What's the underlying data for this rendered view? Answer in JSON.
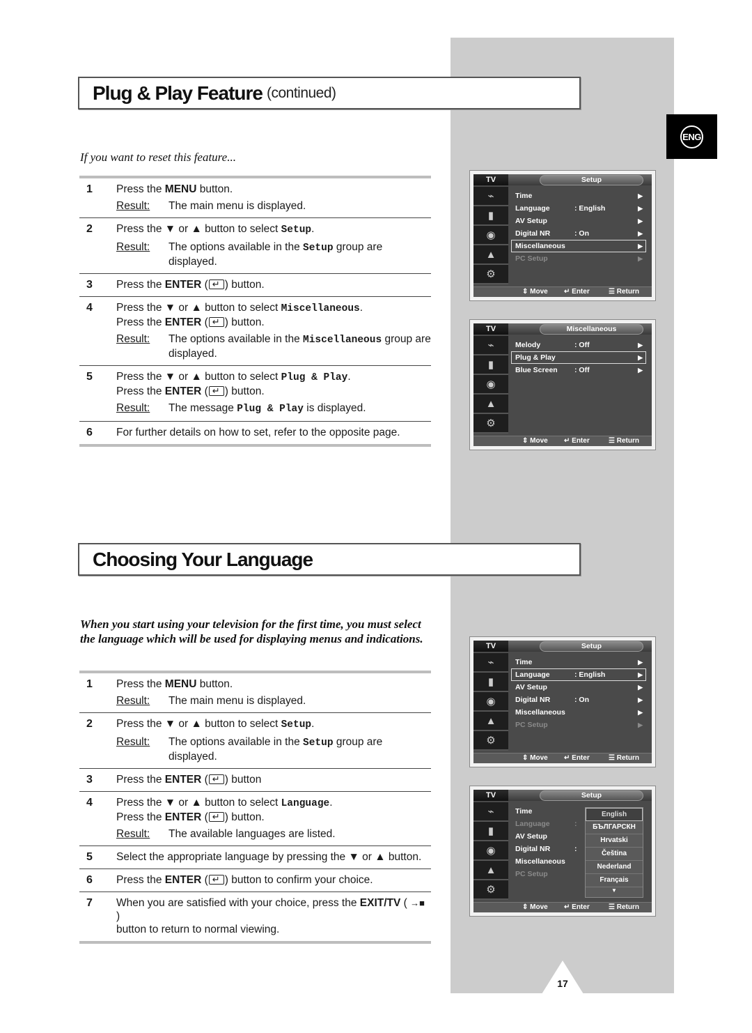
{
  "page_number": "17",
  "language_badge": "ENG",
  "section1": {
    "title": "Plug & Play Feature",
    "title_suffix": "(continued)",
    "intro": "If you want to reset this feature...",
    "steps": [
      {
        "num": "1",
        "parts": [
          "Press the ",
          "MENU",
          " button."
        ],
        "result_label": "Result:",
        "result": "The main menu is displayed."
      },
      {
        "num": "2",
        "parts": [
          "Press the ▼ or ▲ button to select ",
          "Setup",
          "."
        ],
        "result_label": "Result:",
        "result_parts": [
          "The options available in the ",
          "Setup",
          " group are displayed."
        ]
      },
      {
        "num": "3",
        "parts": [
          "Press the ",
          "ENTER",
          " (",
          ") button."
        ]
      },
      {
        "num": "4",
        "line1": [
          "Press the ▼ or ▲ button to select ",
          "Miscellaneous",
          "."
        ],
        "line2": [
          "Press the ",
          "ENTER",
          " (",
          ") button."
        ],
        "result_label": "Result:",
        "result_parts": [
          "The options available in the ",
          "Miscellaneous",
          " group are displayed."
        ]
      },
      {
        "num": "5",
        "line1": [
          "Press the ▼ or ▲ button to select ",
          "Plug & Play",
          "."
        ],
        "line2": [
          "Press the ",
          "ENTER",
          " (",
          ") button."
        ],
        "result_label": "Result:",
        "result_parts": [
          "The message ",
          "Plug & Play",
          " is displayed."
        ]
      },
      {
        "num": "6",
        "text": "For further details on how to set, refer to the opposite page."
      }
    ]
  },
  "section2": {
    "title": "Choosing Your Language",
    "intro": "When you start using your television for the first time, you must select the language which will be used for displaying menus and indications.",
    "steps": [
      {
        "num": "1",
        "parts": [
          "Press the ",
          "MENU",
          " button."
        ],
        "result_label": "Result:",
        "result": "The main menu is displayed."
      },
      {
        "num": "2",
        "parts": [
          "Press the ▼ or ▲ button to select ",
          "Setup",
          "."
        ],
        "result_label": "Result:",
        "result_parts": [
          "The options available in the ",
          "Setup",
          " group are displayed."
        ]
      },
      {
        "num": "3",
        "parts": [
          "Press the ",
          "ENTER",
          " (",
          ") button"
        ]
      },
      {
        "num": "4",
        "line1": [
          "Press the ▼ or ▲ button to select ",
          "Language",
          "."
        ],
        "line2": [
          "Press the ",
          "ENTER",
          " (",
          ") button."
        ],
        "result_label": "Result:",
        "result": "The available languages are listed."
      },
      {
        "num": "5",
        "text": "Select the appropriate language by pressing the ▼ or ▲ button."
      },
      {
        "num": "6",
        "parts": [
          "Press the ",
          "ENTER",
          " (",
          ") button to confirm your choice."
        ]
      },
      {
        "num": "7",
        "parts": [
          "When you are satisfied with your choice, press the ",
          "EXIT/TV",
          " ( ",
          " )"
        ],
        "line2": "button to return to normal viewing."
      }
    ]
  },
  "osd_common": {
    "tv_label": "TV",
    "icons": [
      "input-icon",
      "picture-icon",
      "sound-icon",
      "channel-icon",
      "setup-icon"
    ],
    "footer": {
      "move": "Move",
      "enter": "Enter",
      "return": "Return"
    }
  },
  "osd_screens": [
    {
      "header": "Setup",
      "rows": [
        {
          "label": "Time",
          "value": "",
          "arrow": "▶",
          "selected": false,
          "dim": false
        },
        {
          "label": "Language",
          "value": ": English",
          "arrow": "▶",
          "selected": false,
          "dim": false
        },
        {
          "label": "AV Setup",
          "value": "",
          "arrow": "▶",
          "selected": false,
          "dim": false
        },
        {
          "label": "Digital NR",
          "value": ": On",
          "arrow": "▶",
          "selected": false,
          "dim": false
        },
        {
          "label": "Miscellaneous",
          "value": "",
          "arrow": "▶",
          "selected": true,
          "dim": false
        },
        {
          "label": "PC Setup",
          "value": "",
          "arrow": "▶",
          "selected": false,
          "dim": true
        }
      ]
    },
    {
      "header": "Miscellaneous",
      "rows": [
        {
          "label": "Melody",
          "value": ": Off",
          "arrow": "▶",
          "selected": false,
          "dim": false
        },
        {
          "label": "Plug & Play",
          "value": "",
          "arrow": "▶",
          "selected": true,
          "dim": false
        },
        {
          "label": "Blue Screen",
          "value": ": Off",
          "arrow": "▶",
          "selected": false,
          "dim": false
        }
      ]
    },
    {
      "header": "Setup",
      "rows": [
        {
          "label": "Time",
          "value": "",
          "arrow": "▶",
          "selected": false,
          "dim": false
        },
        {
          "label": "Language",
          "value": ": English",
          "arrow": "▶",
          "selected": true,
          "dim": false
        },
        {
          "label": "AV Setup",
          "value": "",
          "arrow": "▶",
          "selected": false,
          "dim": false
        },
        {
          "label": "Digital NR",
          "value": ": On",
          "arrow": "▶",
          "selected": false,
          "dim": false
        },
        {
          "label": "Miscellaneous",
          "value": "",
          "arrow": "▶",
          "selected": false,
          "dim": false
        },
        {
          "label": "PC Setup",
          "value": "",
          "arrow": "▶",
          "selected": false,
          "dim": true
        }
      ]
    },
    {
      "header": "Setup",
      "rows": [
        {
          "label": "Time",
          "value": "",
          "arrow": "",
          "selected": false,
          "dim": false
        },
        {
          "label": "Language",
          "value": ":",
          "arrow": "",
          "selected": false,
          "dim": true
        },
        {
          "label": "AV Setup",
          "value": "",
          "arrow": "",
          "selected": false,
          "dim": false
        },
        {
          "label": "Digital NR",
          "value": ":",
          "arrow": "",
          "selected": false,
          "dim": false
        },
        {
          "label": "Miscellaneous",
          "value": "",
          "arrow": "",
          "selected": false,
          "dim": false
        },
        {
          "label": "PC Setup",
          "value": "",
          "arrow": "",
          "selected": false,
          "dim": true
        }
      ],
      "dropdown": {
        "options": [
          "English",
          "БЪЛГАРСКН",
          "Hrvatski",
          "Čeština",
          "Nederland",
          "Français"
        ],
        "selected": "English",
        "more_indicator": "▼"
      }
    }
  ]
}
